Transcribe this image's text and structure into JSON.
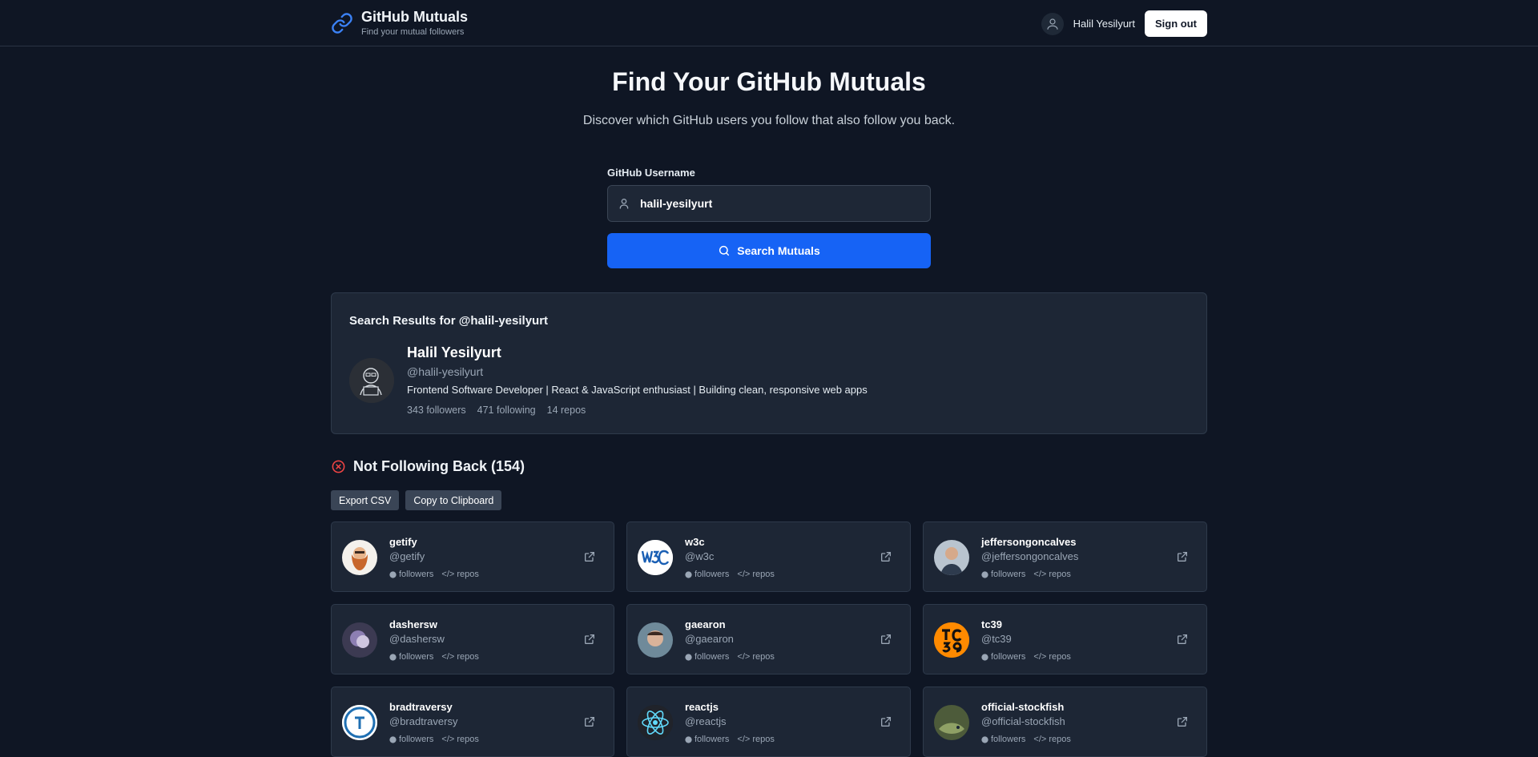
{
  "header": {
    "brand_title": "GitHub Mutuals",
    "brand_subtitle": "Find your mutual followers",
    "user_name": "Halil Yesilyurt",
    "signout_label": "Sign out"
  },
  "hero": {
    "title": "Find Your GitHub Mutuals",
    "subtitle": "Discover which GitHub users you follow that also follow you back."
  },
  "form": {
    "label": "GitHub Username",
    "username_value": "halil-yesilyurt",
    "search_label": "Search Mutuals"
  },
  "result": {
    "heading": "Search Results for @halil-yesilyurt",
    "name": "Halil Yesilyurt",
    "handle": "@halil-yesilyurt",
    "bio": "Frontend Software Developer | React & JavaScript enthusiast | Building clean, responsive web apps",
    "followers": "343 followers",
    "following": "471 following",
    "repos": "14 repos"
  },
  "section": {
    "title": "Not Following Back (154)",
    "export_label": "Export CSV",
    "copy_label": "Copy to Clipboard"
  },
  "meta_labels": {
    "followers": "followers",
    "repos": "repos"
  },
  "users": [
    {
      "name": "getify",
      "handle": "@getify"
    },
    {
      "name": "w3c",
      "handle": "@w3c"
    },
    {
      "name": "jeffersongoncalves",
      "handle": "@jeffersongoncalves"
    },
    {
      "name": "dashersw",
      "handle": "@dashersw"
    },
    {
      "name": "gaearon",
      "handle": "@gaearon"
    },
    {
      "name": "tc39",
      "handle": "@tc39"
    },
    {
      "name": "bradtraversy",
      "handle": "@bradtraversy"
    },
    {
      "name": "reactjs",
      "handle": "@reactjs"
    },
    {
      "name": "official-stockfish",
      "handle": "@official-stockfish"
    }
  ],
  "colors": {
    "background": "#0f1624",
    "card": "#1d2635",
    "accent": "#1663f5",
    "danger": "#ef4444"
  }
}
